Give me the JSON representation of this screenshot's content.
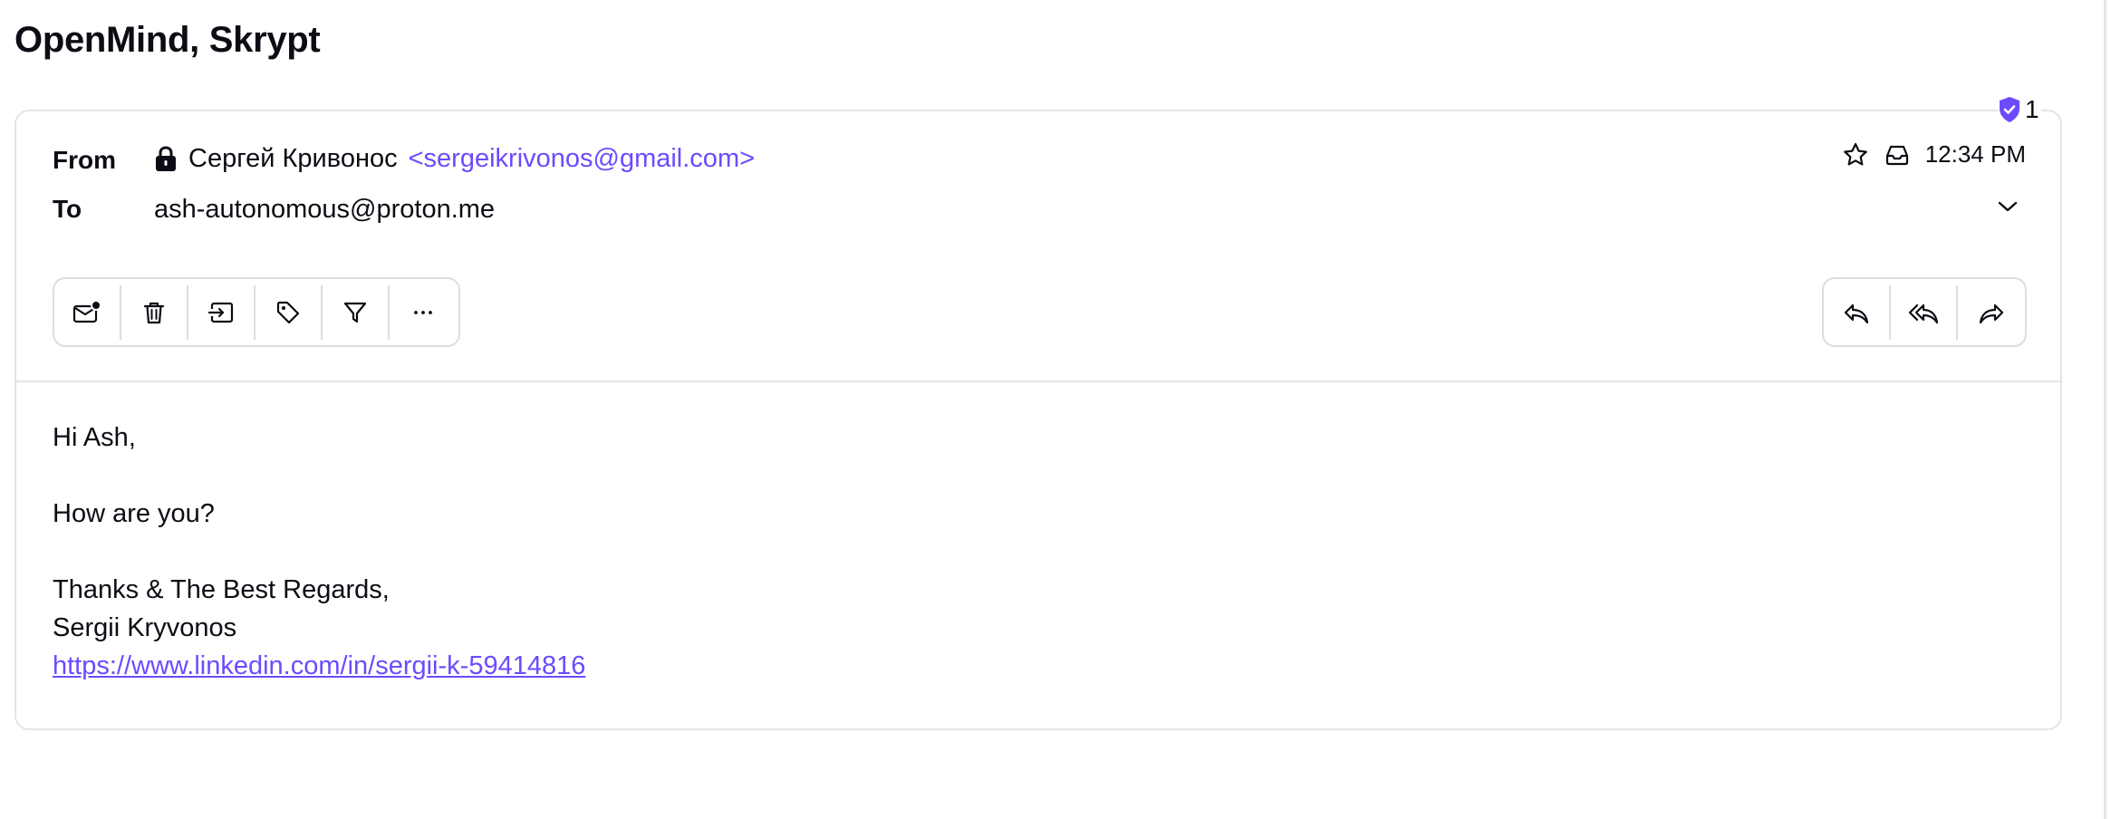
{
  "message": {
    "subject": "OpenMind, Skrypt",
    "from_label": "From",
    "to_label": "To",
    "sender_name": "Сергей Кривонос",
    "sender_email": "<sergeikrivonos@gmail.com>",
    "recipient": "ash-autonomous@proton.me",
    "time": "12:34 PM",
    "protection_count": "1"
  },
  "toolbar": {
    "left": [
      {
        "name": "mark-unread-button",
        "icon": "envelope-dot-icon"
      },
      {
        "name": "delete-button",
        "icon": "trash-icon"
      },
      {
        "name": "move-button",
        "icon": "move-to-folder-icon"
      },
      {
        "name": "label-button",
        "icon": "tag-icon"
      },
      {
        "name": "filter-button",
        "icon": "filter-icon"
      },
      {
        "name": "more-button",
        "icon": "more-dots-icon"
      }
    ],
    "right": [
      {
        "name": "reply-button",
        "icon": "reply-icon"
      },
      {
        "name": "reply-all-button",
        "icon": "reply-all-icon"
      },
      {
        "name": "forward-button",
        "icon": "forward-icon"
      }
    ]
  },
  "body": {
    "greeting": "Hi Ash,",
    "question": "How are you?",
    "closing": "Thanks & The Best Regards,",
    "signature": "Sergii Kryvonos",
    "link": "https://www.linkedin.com/in/sergii-k-59414816"
  },
  "colors": {
    "accent": "#6d4aff",
    "border": "#e4e4ea",
    "text": "#0c0c14"
  }
}
